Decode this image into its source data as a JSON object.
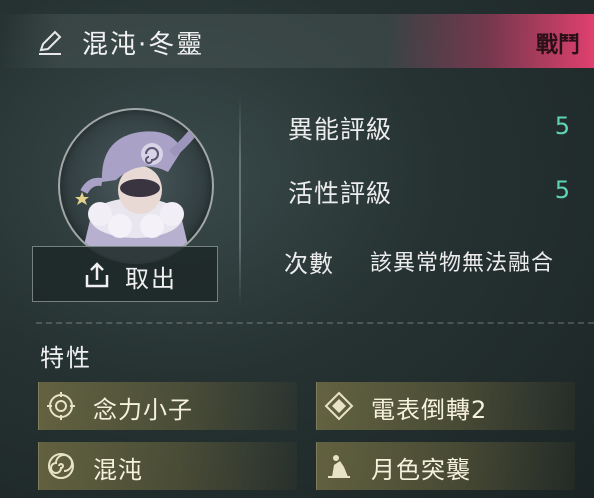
{
  "header": {
    "title": "混沌·冬靈",
    "mode_tag": "戰鬥",
    "edit_icon": "pencil-icon"
  },
  "portrait": {
    "icon": "character-portrait"
  },
  "take_button": {
    "label": "取出",
    "icon": "export-icon"
  },
  "stats": [
    {
      "label": "異能評級",
      "value": "5"
    },
    {
      "label": "活性評級",
      "value": "5"
    }
  ],
  "fusion": {
    "label": "次數",
    "value": "該異常物無法融合"
  },
  "traits": {
    "heading": "特性",
    "items": [
      {
        "label": "念力小子",
        "icon": "telekinesis-icon"
      },
      {
        "label": "電表倒轉2",
        "icon": "diamond-icon"
      },
      {
        "label": "混沌",
        "icon": "swirl-icon"
      },
      {
        "label": "月色突襲",
        "icon": "moon-raid-icon"
      }
    ]
  },
  "colors": {
    "accent_pink": "#e0406e",
    "stat_value": "#5fd4b4",
    "trait_gold": "#968c50"
  }
}
